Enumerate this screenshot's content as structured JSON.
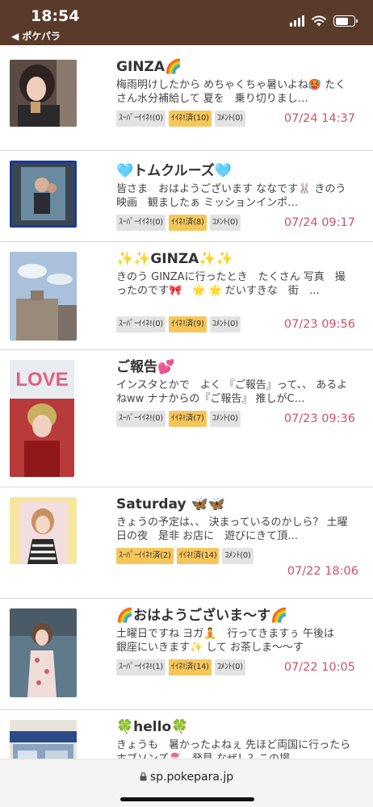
{
  "status": {
    "time": "18:54",
    "back": "◀ ポケパラ"
  },
  "posts": [
    {
      "title": "GINZA🌈",
      "excerpt": "梅雨明けしたから めちゃくちゃ暑いよね🥵 たくさん水分補給して 夏を　乗り切りまし…",
      "super": "ｽｰﾊﾟｰｲｲﾈ!(0)",
      "iine": "ｲｲﾈ!済(10)",
      "comment": "ｺﾒﾝﾄ(0)",
      "date": "07/24 14:37"
    },
    {
      "title": "🩵トムクルーズ🩵",
      "excerpt": "皆さま　おはようございます ななです🐰 きのう　映画　観ましたぁ ミッションインポ…",
      "super": "ｽｰﾊﾟｰｲｲﾈ!(0)",
      "iine": "ｲｲﾈ!済(8)",
      "comment": "ｺﾒﾝﾄ(0)",
      "date": "07/24 09:17"
    },
    {
      "title": "✨✨GINZA✨✨",
      "excerpt": "きのう GINZAに行ったとき　たくさん 写真　撮ったのです🎀　🌟 🌟 だいすきな　街　…",
      "super": "ｽｰﾊﾟｰｲｲﾈ!(0)",
      "iine": "ｲｲﾈ!済(9)",
      "comment": "ｺﾒﾝﾄ(0)",
      "date": "07/23 09:56"
    },
    {
      "title": "ご報告💕",
      "excerpt": "インスタとかで　よく 『ご報告』って、、 あるよねww ナナからの『ご報告』 推しがC…",
      "super": "ｽｰﾊﾟｰｲｲﾈ!(0)",
      "iine": "ｲｲﾈ!済(7)",
      "comment": "ｺﾒﾝﾄ(0)",
      "date": "07/23 09:36"
    },
    {
      "title": "Saturday 🦋🦋",
      "excerpt": "きょうの予定は、、 決まっているのかしら？ 土曜日の夜　是非 お店に　遊びにきて頂…",
      "super": "ｽｰﾊﾟｰｲｲﾈ!済(2)",
      "iine": "ｲｲﾈ!済(14)",
      "comment": "ｺﾒﾝﾄ(0)",
      "date": "07/22 18:06"
    },
    {
      "title": "🌈おはようございま〜す🌈",
      "excerpt": "土曜日ですね ヨガ🧘　行ってきますぅ 午後は　銀座にいきます✨ して お茶しま〜〜す",
      "super": "ｽｰﾊﾟｰｲｲﾈ!(1)",
      "iine": "ｲｲﾈ!済(14)",
      "comment": "ｺﾒﾝﾄ(0)",
      "date": "07/22 10:05"
    },
    {
      "title": "🍀hello🍀",
      "excerpt": "きょうも　暑かったよねぇ 先ほど両国に行ったら ホブソンズ🍧　発見 なぜ！？この場…"
    }
  ],
  "address_bar": {
    "url": "sp.pokepara.jp"
  }
}
